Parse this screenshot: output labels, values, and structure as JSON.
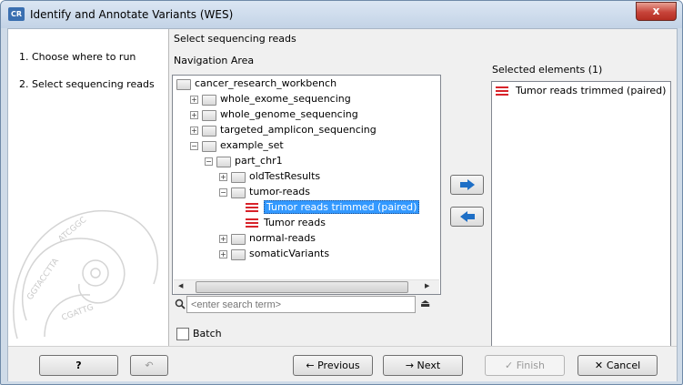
{
  "window": {
    "title": "Identify and Annotate Variants (WES)",
    "app_icon": "CR",
    "close": "x"
  },
  "steps": [
    {
      "label": "1.  Choose where to run"
    },
    {
      "label": "2.  Select sequencing reads"
    }
  ],
  "main": {
    "section_title": "Select sequencing reads",
    "nav_label": "Navigation Area",
    "selected_label": "Selected elements (1)"
  },
  "tree": [
    {
      "label": "cancer_research_workbench",
      "depth": 0,
      "kind": "folder-open",
      "expander": ""
    },
    {
      "label": "whole_exome_sequencing",
      "depth": 1,
      "kind": "folder",
      "expander": "+"
    },
    {
      "label": "whole_genome_sequencing",
      "depth": 1,
      "kind": "folder",
      "expander": "+"
    },
    {
      "label": "targeted_amplicon_sequencing",
      "depth": 1,
      "kind": "folder",
      "expander": "+"
    },
    {
      "label": "example_set",
      "depth": 1,
      "kind": "folder-open",
      "expander": "-"
    },
    {
      "label": "part_chr1",
      "depth": 2,
      "kind": "folder-open",
      "expander": "-"
    },
    {
      "label": "oldTestResults",
      "depth": 3,
      "kind": "folder",
      "expander": "+"
    },
    {
      "label": "tumor-reads",
      "depth": 3,
      "kind": "folder-open",
      "expander": "-"
    },
    {
      "label": "Tumor reads trimmed (paired)",
      "depth": 4,
      "kind": "reads",
      "expander": "",
      "selected": true
    },
    {
      "label": "Tumor reads",
      "depth": 4,
      "kind": "reads",
      "expander": ""
    },
    {
      "label": "normal-reads",
      "depth": 3,
      "kind": "folder",
      "expander": "+"
    },
    {
      "label": "somaticVariants",
      "depth": 3,
      "kind": "folder",
      "expander": "+"
    }
  ],
  "selected_elements": [
    {
      "label": "Tumor reads trimmed (paired)"
    }
  ],
  "search": {
    "placeholder": "<enter search term>"
  },
  "batch": {
    "label": "Batch",
    "checked": false
  },
  "footer": {
    "help": "?",
    "previous": "Previous",
    "next": "Next",
    "finish": "Finish",
    "cancel": "Cancel"
  }
}
